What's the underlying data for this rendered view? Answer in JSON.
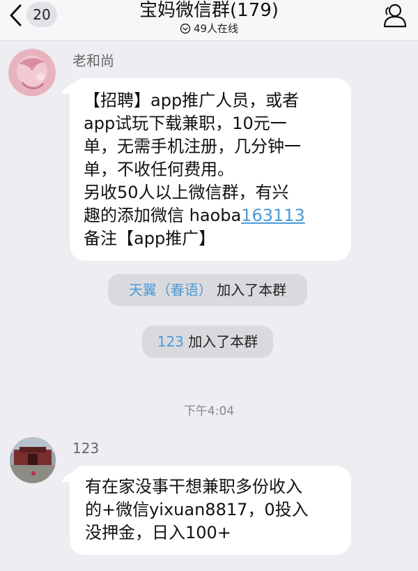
{
  "header": {
    "back_count": "20",
    "title": "宝妈微信群(179)",
    "online": "49人在线"
  },
  "messages": [
    {
      "sender": "老和尚",
      "text_before": "【招聘】app推广人员，或者\napp试玩下载兼职，10元一\n单，无需手机注册，几分钟一\n单，不收任何费用。\n另收50人以上微信群，有兴\n趣的添加微信 haoba",
      "link": "163113",
      "text_after": "\n备注【app推广】"
    },
    {
      "sender": "123",
      "text": "有在家没事干想兼职多份收入\n的+微信yixuan8817，0投入\n没押金，日入100+"
    }
  ],
  "system": [
    {
      "name": "天翼（春语）",
      "action": " 加入了本群"
    },
    {
      "name": "123",
      "action": " 加入了本群"
    }
  ],
  "timestamp": "下午4:04",
  "colors": {
    "link": "#4a9ad8",
    "background": "#ededf2",
    "bubble": "#ffffff",
    "system_pill": "#dadade"
  },
  "icons": [
    "back-chevron-icon",
    "online-clock-icon",
    "group-profile-icon"
  ]
}
